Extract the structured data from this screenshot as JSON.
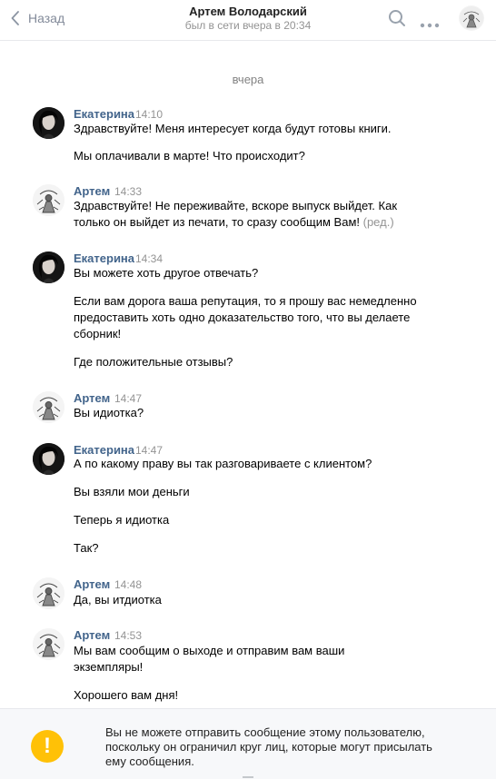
{
  "header": {
    "back_label": "Назад",
    "name": "Артем Володарский",
    "status": "был в сети вчера в 20:34",
    "icons": [
      "chevron-left-icon",
      "search-icon",
      "more-icon",
      "avatar"
    ]
  },
  "day_separator": "вчера",
  "messages": [
    {
      "author": "Екатерина",
      "time": "14:10",
      "lines": [
        "Здравствуйте! Меня интересует когда будут готовы книги.",
        "Мы оплачивали в марте! Что происходит?"
      ]
    },
    {
      "author": "Артем",
      "time": "14:33",
      "lines": [
        "Здравствуйте! Не переживайте, вскоре выпуск выйдет. Как",
        "только он выйдет из печати, то сразу сообщим Вам!"
      ],
      "edited": "(ред.)"
    },
    {
      "author": "Екатерина",
      "time": "14:34",
      "lines": [
        "Вы можете хоть другое отвечать?",
        "Если вам дорога ваша репутация, то я прошу вас немедленно",
        "предоставить хоть одно доказательство того, что вы делаете",
        "сборник!",
        "Где положительные отзывы?"
      ]
    },
    {
      "author": "Артем",
      "time": "14:47",
      "lines": [
        "Вы идиотка?"
      ]
    },
    {
      "author": "Екатерина",
      "time": "14:47",
      "lines": [
        "А по какому праву вы так разговариваете с клиентом?",
        "Вы взяли мои деньги",
        "Теперь я идиотка",
        "Так?"
      ]
    },
    {
      "author": "Артем",
      "time": "14:48",
      "lines": [
        "Да, вы итдиотка"
      ]
    },
    {
      "author": "Артем",
      "time": "14:53",
      "lines": [
        "Мы вам сообщим о выходе и отправим вам ваши",
        "экземпляры!",
        "Хорошего вам дня!"
      ]
    }
  ],
  "footer": {
    "warning_line1": "Вы не можете отправить сообщение этому пользователю,",
    "warning_line2": "поскольку он ограничил круг лиц, которые могут присылать",
    "warning_line3": "ему сообщения.",
    "icon": "warning-icon"
  },
  "colors": {
    "author": "#42648b",
    "meta": "#939393",
    "warning": "#ffc107",
    "footer_bg": "#f7f8fa"
  }
}
